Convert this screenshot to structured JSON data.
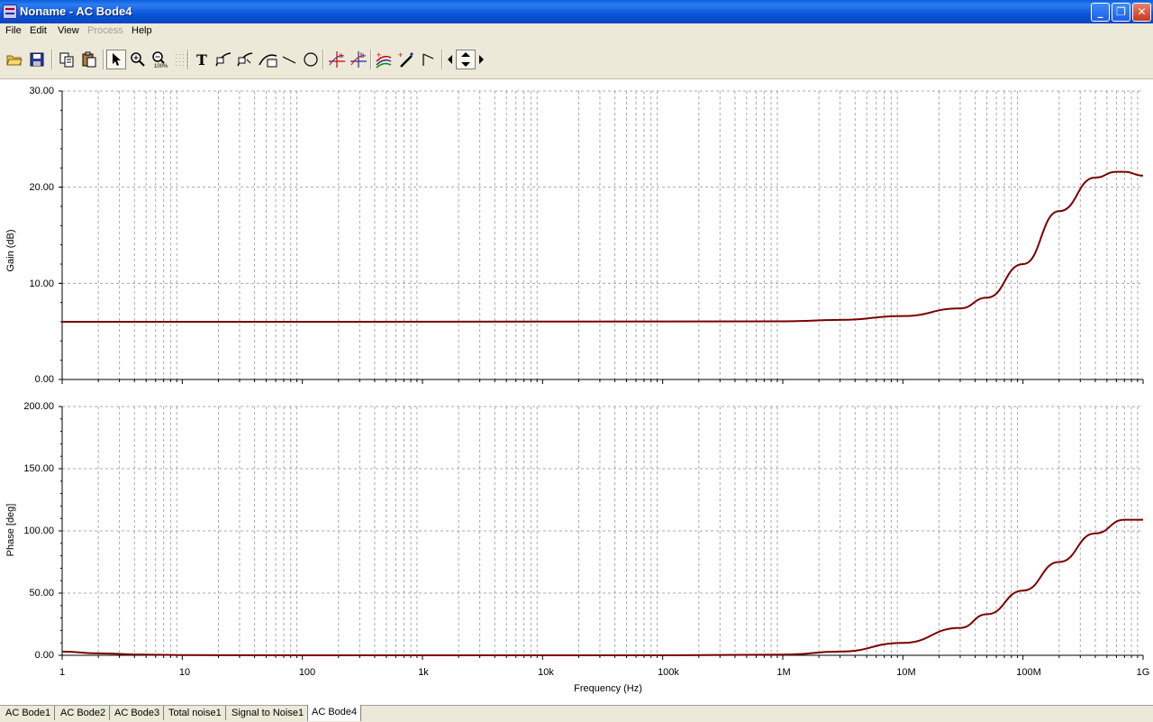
{
  "window": {
    "title": "Noname - AC Bode4",
    "minimize": "_",
    "maximize": "❐",
    "close": "✕"
  },
  "menu": [
    {
      "label": "File",
      "enabled": true
    },
    {
      "label": "Edit",
      "enabled": true
    },
    {
      "label": "View",
      "enabled": true
    },
    {
      "label": "Process",
      "enabled": false
    },
    {
      "label": "Help",
      "enabled": true
    }
  ],
  "toolbar": {
    "text_tool_glyph": "T"
  },
  "colors": {
    "curve": "#7a0000",
    "grid": "#a8a8a8",
    "axis": "#000000"
  },
  "chart_data": [
    {
      "type": "line",
      "ylabel": "Gain (dB)",
      "xlabel": "",
      "x_scale": "log",
      "xlim": [
        1,
        1000000000
      ],
      "ylim": [
        0,
        30
      ],
      "yticks": [
        "30.00",
        "20.00",
        "10.00",
        "0.00"
      ],
      "grid": true,
      "x": [
        1,
        100,
        1000000,
        3000000,
        10000000,
        30000000,
        50000000,
        100000000,
        200000000,
        400000000,
        600000000,
        700000000,
        1000000000
      ],
      "y": [
        6.0,
        6.0,
        6.05,
        6.2,
        6.6,
        7.4,
        8.5,
        12.0,
        17.5,
        21.0,
        21.6,
        21.6,
        21.2
      ]
    },
    {
      "type": "line",
      "ylabel": "Phase [deg]",
      "xlabel": "Frequency (Hz)",
      "x_scale": "log",
      "xlim": [
        1,
        1000000000
      ],
      "ylim": [
        0,
        200
      ],
      "yticks": [
        "200.00",
        "150.00",
        "100.00",
        "50.00",
        "0.00"
      ],
      "xticks": [
        "1",
        "10",
        "100",
        "1k",
        "10k",
        "100k",
        "1M",
        "10M",
        "100M",
        "1G"
      ],
      "grid": true,
      "x": [
        1,
        2,
        5,
        10,
        100,
        100000,
        1000000,
        3000000,
        10000000,
        30000000,
        50000000,
        100000000,
        200000000,
        400000000,
        700000000,
        1000000000
      ],
      "y": [
        3.0,
        1.5,
        0.5,
        0.2,
        0.0,
        0.0,
        0.5,
        3.0,
        10.0,
        22.0,
        33.0,
        52.0,
        75.0,
        98.0,
        109.0,
        109.0
      ]
    }
  ],
  "tabs": [
    {
      "label": "AC Bode1",
      "active": false
    },
    {
      "label": "AC Bode2",
      "active": false
    },
    {
      "label": "AC Bode3",
      "active": false
    },
    {
      "label": "Total noise1",
      "active": false
    },
    {
      "label": "Signal to Noise1",
      "active": false
    },
    {
      "label": "AC Bode4",
      "active": true
    }
  ]
}
